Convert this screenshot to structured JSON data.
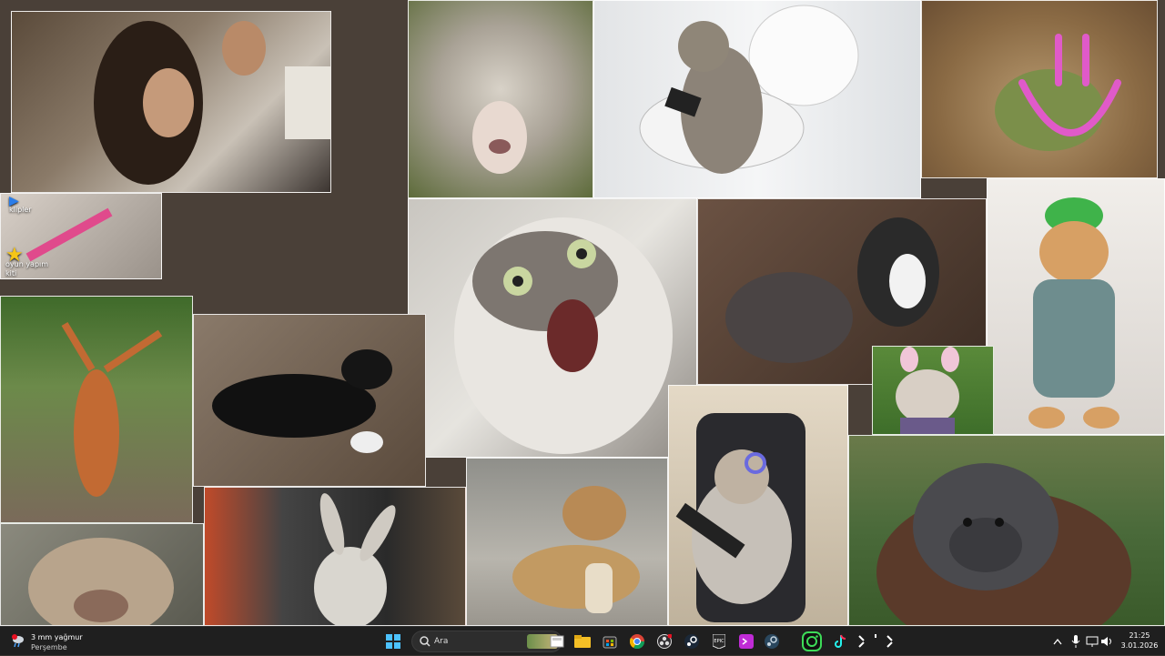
{
  "desktop": {
    "icons": [
      {
        "label": "klipler",
        "icon": "folder-icon"
      },
      {
        "label": "oyun yapım kiti",
        "icon": "star-icon"
      }
    ]
  },
  "taskbar": {
    "weather": {
      "line1": "3 mm yağmur",
      "line2": "Perşembe",
      "badge": "1"
    },
    "search": {
      "placeholder": "Ara"
    },
    "apps": [
      "start-icon",
      "file-explorer-icon",
      "folder-icon",
      "store-icon",
      "chrome-icon",
      "obs-icon",
      "steam-icon",
      "epic-games-icon",
      "terminal-icon",
      "steam-alt-icon",
      "instagram-icon",
      "tiktok-icon",
      "sparkle-icon"
    ],
    "clock": {
      "time": "21:25",
      "date": "3.01.2026"
    }
  },
  "colors": {
    "taskbar_bg": "#1f1f1f",
    "accent": "#0078d4"
  }
}
